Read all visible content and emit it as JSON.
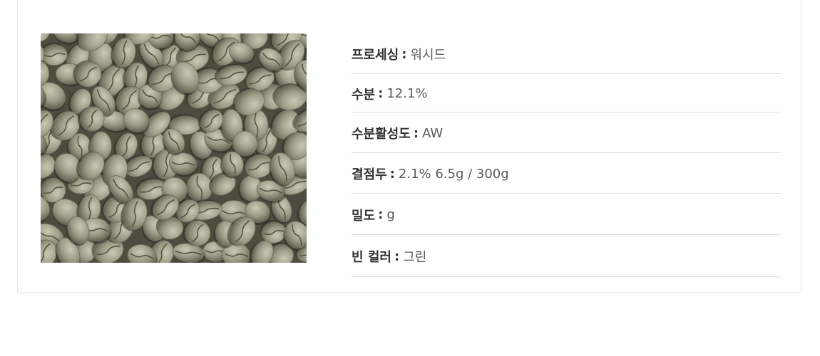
{
  "product_image": {
    "alt": "green coffee beans",
    "icon": "green-coffee-beans-photo"
  },
  "specs": [
    {
      "label": "프로세싱",
      "value": "워시드"
    },
    {
      "label": "수분",
      "value": "12.1%"
    },
    {
      "label": "수분활성도",
      "value": "AW"
    },
    {
      "label": "결점두",
      "value": "2.1% 6.5g / 300g"
    },
    {
      "label": "밀도",
      "value": "g"
    },
    {
      "label": "빈 컬러",
      "value": "그린"
    }
  ],
  "separator": ":",
  "colors": {
    "label": "#333333",
    "value": "#5a5a5a",
    "divider": "#dedede",
    "card_border": "#e6e6e6"
  }
}
